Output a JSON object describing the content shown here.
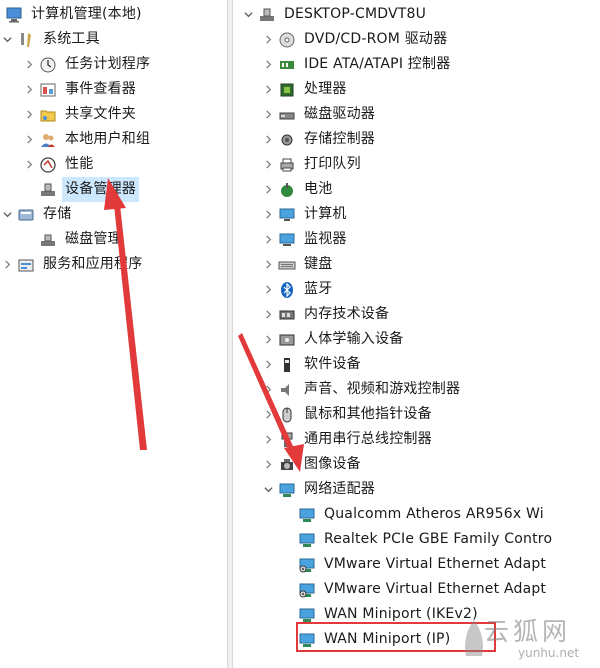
{
  "left_tree": {
    "root": "计算机管理(本地)",
    "items": [
      {
        "label": "系统工具",
        "icon": "tools-icon",
        "expanded": true,
        "level": 1
      },
      {
        "label": "任务计划程序",
        "icon": "clock-icon",
        "level": 2
      },
      {
        "label": "事件查看器",
        "icon": "event-viewer-icon",
        "level": 2
      },
      {
        "label": "共享文件夹",
        "icon": "shared-folder-icon",
        "level": 2
      },
      {
        "label": "本地用户和组",
        "icon": "users-icon",
        "level": 2
      },
      {
        "label": "性能",
        "icon": "performance-icon",
        "level": 2
      },
      {
        "label": "设备管理器",
        "icon": "device-manager-icon",
        "level": 2,
        "selected": true
      },
      {
        "label": "存储",
        "icon": "storage-icon",
        "expanded": true,
        "level": 1
      },
      {
        "label": "磁盘管理",
        "icon": "disk-icon",
        "level": 2
      },
      {
        "label": "服务和应用程序",
        "icon": "services-icon",
        "level": 1
      }
    ]
  },
  "device_tree": {
    "root": "DESKTOP-CMDVT8U",
    "categories": [
      {
        "label": "DVD/CD-ROM 驱动器",
        "icon": "dvd-icon"
      },
      {
        "label": "IDE ATA/ATAPI 控制器",
        "icon": "ide-icon"
      },
      {
        "label": "处理器",
        "icon": "cpu-icon"
      },
      {
        "label": "磁盘驱动器",
        "icon": "disk-drive-icon"
      },
      {
        "label": "存储控制器",
        "icon": "storage-controller-icon"
      },
      {
        "label": "打印队列",
        "icon": "printer-icon"
      },
      {
        "label": "电池",
        "icon": "battery-icon"
      },
      {
        "label": "计算机",
        "icon": "computer-icon"
      },
      {
        "label": "监视器",
        "icon": "monitor-icon"
      },
      {
        "label": "键盘",
        "icon": "keyboard-icon"
      },
      {
        "label": "蓝牙",
        "icon": "bluetooth-icon"
      },
      {
        "label": "内存技术设备",
        "icon": "memory-icon"
      },
      {
        "label": "人体学输入设备",
        "icon": "hid-icon"
      },
      {
        "label": "软件设备",
        "icon": "software-device-icon"
      },
      {
        "label": "声音、视频和游戏控制器",
        "icon": "speaker-icon"
      },
      {
        "label": "鼠标和其他指针设备",
        "icon": "mouse-icon"
      },
      {
        "label": "通用串行总线控制器",
        "icon": "usb-icon"
      },
      {
        "label": "图像设备",
        "icon": "camera-icon"
      },
      {
        "label": "网络适配器",
        "icon": "network-icon",
        "expanded": true
      }
    ],
    "network_adapters": [
      "Qualcomm Atheros AR956x Wi",
      "Realtek PCIe GBE Family Contro",
      "VMware Virtual Ethernet Adapt",
      "VMware Virtual Ethernet Adapt",
      "WAN Miniport (IKEv2)",
      "WAN Miniport (IP)"
    ]
  },
  "watermark": {
    "text": "云狐网",
    "url": "yunhu.net"
  },
  "colors": {
    "selection": "#cce8ff",
    "annotation_red": "#e23a3a"
  }
}
